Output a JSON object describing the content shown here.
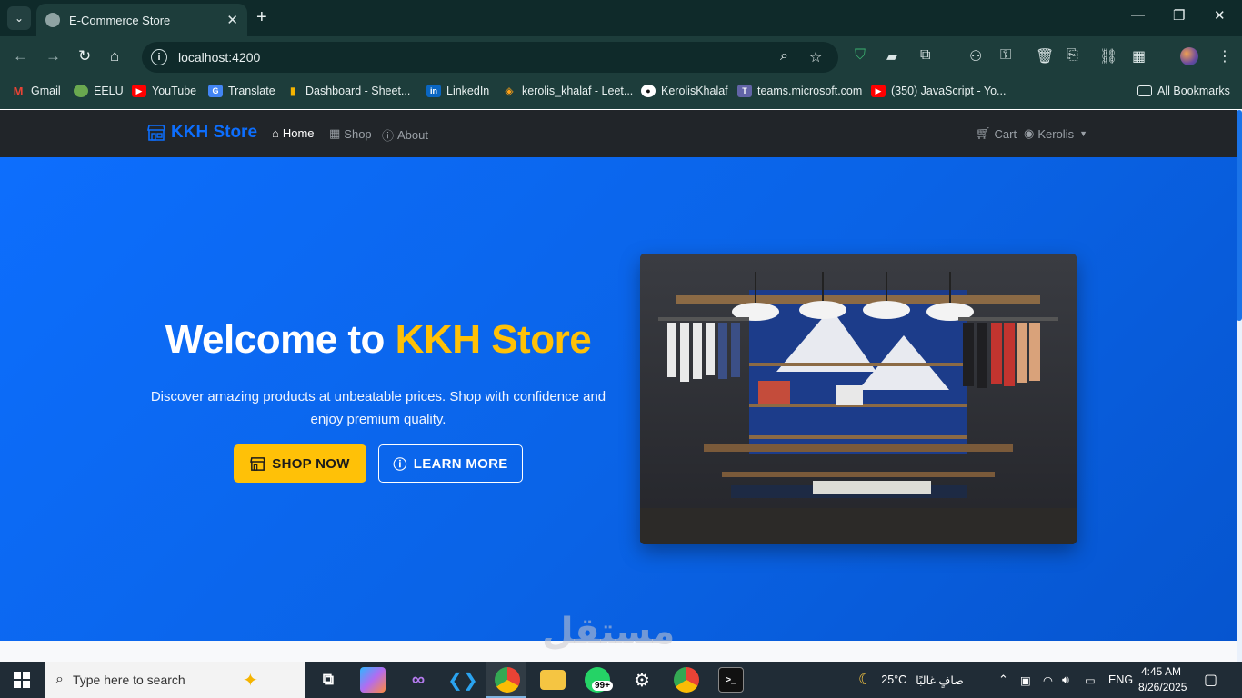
{
  "browser": {
    "tab_title": "E-Commerce Store",
    "tab_close": "✕",
    "new_tab": "+",
    "url": "localhost:4200",
    "bookmarks": [
      {
        "label": "Gmail",
        "icon": "gmail-icon",
        "color": "#ea4335"
      },
      {
        "label": "EELU",
        "icon": "eelu-icon",
        "color": "#6aa84f"
      },
      {
        "label": "YouTube",
        "icon": "youtube-icon",
        "color": "#ff0000"
      },
      {
        "label": "Translate",
        "icon": "translate-icon",
        "color": "#4285f4"
      },
      {
        "label": "Dashboard - Sheet...",
        "icon": "dashboard-icon",
        "color": "#f4b400"
      },
      {
        "label": "LinkedIn",
        "icon": "linkedin-icon",
        "color": "#0a66c2"
      },
      {
        "label": "kerolis_khalaf - Leet...",
        "icon": "leetcode-icon",
        "color": "#ffa116"
      },
      {
        "label": "KerolisKhalaf",
        "icon": "github-icon",
        "color": "#ffffff"
      },
      {
        "label": "teams.microsoft.com",
        "icon": "teams-icon",
        "color": "#6264a7"
      },
      {
        "label": "(350) JavaScript - Yo...",
        "icon": "youtube-icon",
        "color": "#ff0000"
      }
    ],
    "all_bookmarks": "All Bookmarks"
  },
  "nav": {
    "brand": "KKH Store",
    "home": "Home",
    "shop": "Shop",
    "about": "About",
    "cart": "Cart",
    "user": "Kerolis"
  },
  "hero": {
    "title_prefix": "Welcome to ",
    "title_accent": "KKH Store",
    "subtitle": "Discover amazing products at unbeatable prices. Shop with confidence and enjoy premium quality.",
    "shop_button": "SHOP NOW",
    "learn_button": "LEARN MORE"
  },
  "colors": {
    "primary": "#0d6efd",
    "accent": "#ffc107",
    "navbar": "#212529"
  },
  "taskbar": {
    "search_placeholder": "Type here to search",
    "badge": "99+",
    "temperature": "25°C",
    "weather": "صافٍ غالبًا",
    "language": "ENG",
    "time": "4:45 AM",
    "date": "8/26/2025"
  }
}
